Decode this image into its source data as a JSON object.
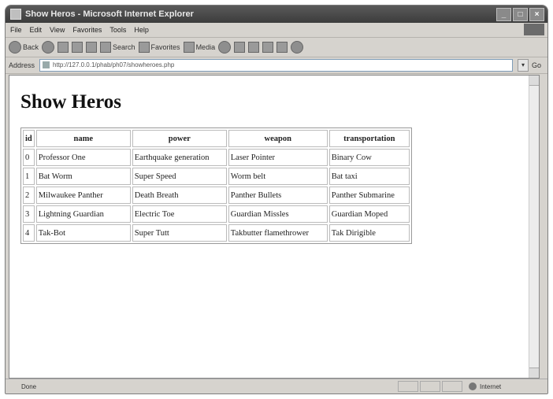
{
  "window": {
    "title": "Show Heros - Microsoft Internet Explorer",
    "controls": [
      "_",
      "□",
      "×"
    ]
  },
  "menu": [
    "File",
    "Edit",
    "View",
    "Favorites",
    "Tools",
    "Help"
  ],
  "toolbar": {
    "back_label": "Back",
    "search_label": "Search",
    "favorites_label": "Favorites",
    "media_label": "Media"
  },
  "address": {
    "label": "Address",
    "url": "http://127.0.0.1/phab/ph07/showheroes.php",
    "go_label": "Go"
  },
  "page": {
    "title": "Show Heros"
  },
  "table": {
    "headers": [
      "id",
      "name",
      "power",
      "weapon",
      "transportation"
    ],
    "rows": [
      [
        "0",
        "Professor One",
        "Earthquake generation",
        "Laser Pointer",
        "Binary Cow"
      ],
      [
        "1",
        "Bat Worm",
        "Super Speed",
        "Worm belt",
        "Bat taxi"
      ],
      [
        "2",
        "Milwaukee Panther",
        "Death Breath",
        "Panther Bullets",
        "Panther Submarine"
      ],
      [
        "3",
        "Lightning Guardian",
        "Electric Toe",
        "Guardian Missles",
        "Guardian Moped"
      ],
      [
        "4",
        "Tak-Bot",
        "Super Tutt",
        "Takbutter flamethrower",
        "Tak Dirigible"
      ]
    ]
  },
  "status": {
    "left": "Done",
    "zone": "Internet"
  }
}
